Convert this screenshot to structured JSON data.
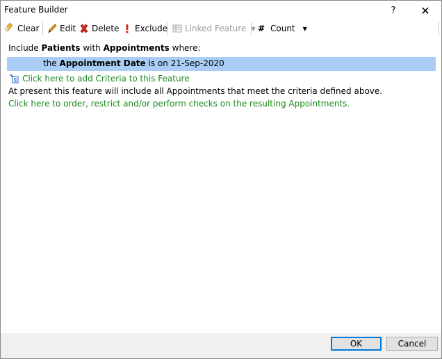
{
  "window": {
    "title": "Feature Builder",
    "help_label": "?",
    "close_label": "✕"
  },
  "toolbar": {
    "clear": "Clear",
    "edit": "Edit",
    "delete": "Delete",
    "exclude": "Exclude",
    "linked_feature": "Linked Feature",
    "count": "Count",
    "count_symbol": "#"
  },
  "criteria": {
    "include_word": "Include",
    "entity": "Patients",
    "with_word": "with",
    "related": "Appointments",
    "where_word": "where:",
    "row_prefix": "the",
    "field": "Appointment Date",
    "operator": "is on",
    "value": "21-Sep-2020",
    "add_link": "Click here to add Criteria to this Feature",
    "summary": "At present this feature will include all Appointments that meet the criteria defined above.",
    "order_link": "Click here to order, restrict and/or perform checks on the resulting Appointments."
  },
  "buttons": {
    "ok": "OK",
    "cancel": "Cancel"
  },
  "colors": {
    "highlight": "#a9cdf4",
    "link_green": "#1a8a1a",
    "default_button_border": "#0078d7"
  }
}
